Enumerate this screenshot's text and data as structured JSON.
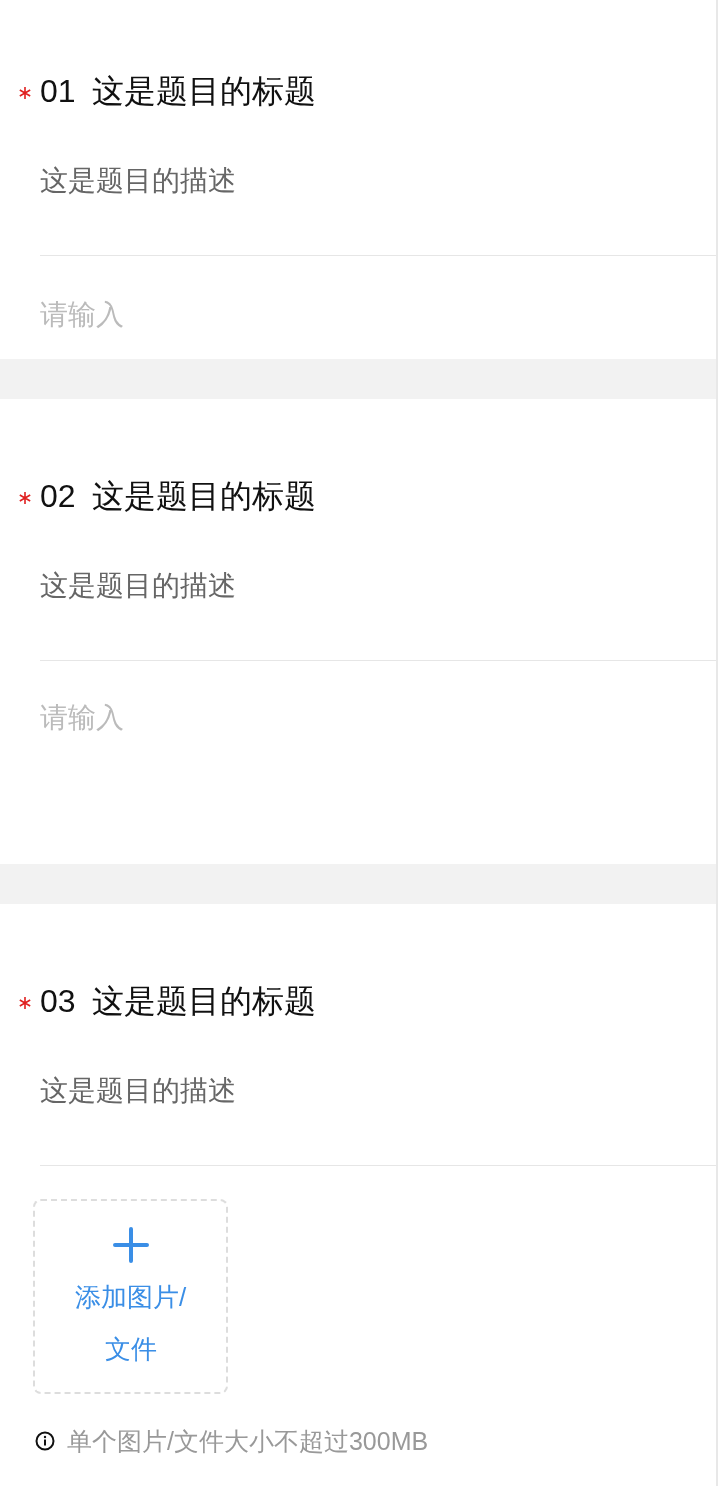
{
  "questions": [
    {
      "number": "01",
      "title": "这是题目的标题",
      "required": true,
      "description": "这是题目的描述",
      "kind": "text",
      "placeholder": "请输入"
    },
    {
      "number": "02",
      "title": "这是题目的标题",
      "required": true,
      "description": "这是题目的描述",
      "kind": "textarea",
      "placeholder": "请输入"
    },
    {
      "number": "03",
      "title": "这是题目的标题",
      "required": true,
      "description": "这是题目的描述",
      "kind": "upload",
      "upload_label": "添加图片/文件",
      "hint": "单个图片/文件大小不超过300MB"
    }
  ]
}
